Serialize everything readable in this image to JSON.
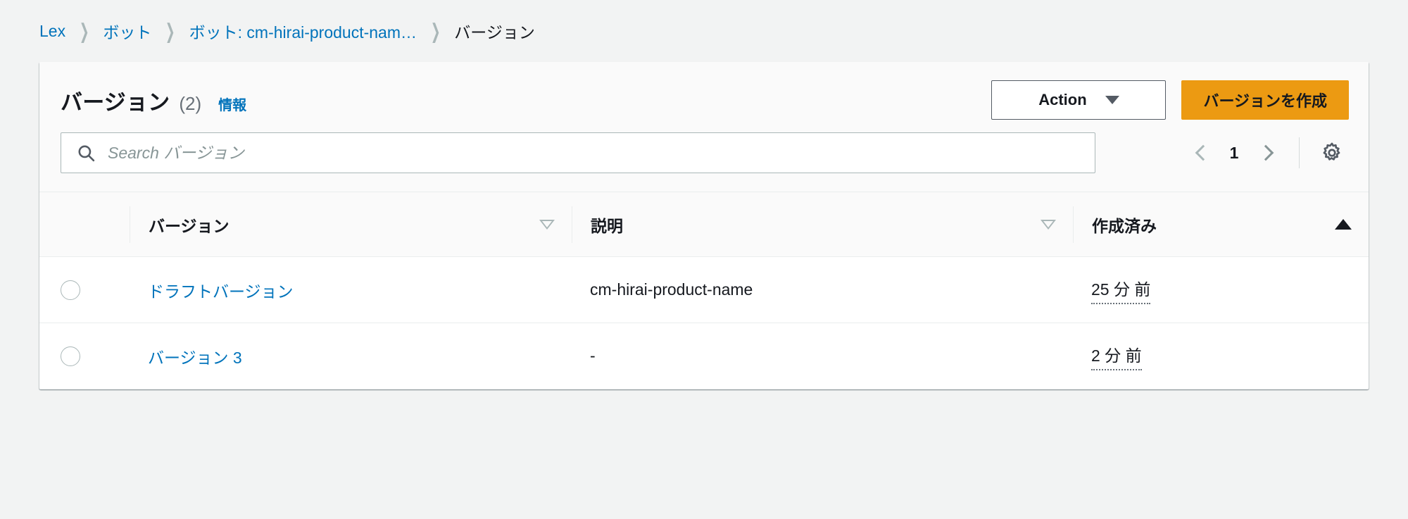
{
  "breadcrumb": {
    "items": [
      {
        "label": "Lex",
        "current": false
      },
      {
        "label": "ボット",
        "current": false
      },
      {
        "label": "ボット: cm-hirai-product-nam…",
        "current": false
      },
      {
        "label": "バージョン",
        "current": true
      }
    ],
    "separator": "❯"
  },
  "panel": {
    "title": "バージョン",
    "count": "(2)",
    "info_label": "情報",
    "actions": {
      "action_button": "Action",
      "create_button": "バージョンを作成"
    }
  },
  "search": {
    "placeholder": "Search バージョン",
    "value": ""
  },
  "pagination": {
    "page": "1",
    "prev_label": "前へ",
    "next_label": "次へ",
    "settings_label": "設定"
  },
  "table": {
    "columns": [
      {
        "key": "select",
        "label": "",
        "sort": "none"
      },
      {
        "key": "version",
        "label": "バージョン",
        "sort": "inactive"
      },
      {
        "key": "description",
        "label": "説明",
        "sort": "inactive"
      },
      {
        "key": "created",
        "label": "作成済み",
        "sort": "asc"
      }
    ],
    "rows": [
      {
        "version": "ドラフトバージョン",
        "description": "cm-hirai-product-name",
        "created": "25 分 前",
        "selected": false
      },
      {
        "version": "バージョン 3",
        "description": "-",
        "created": "2 分 前",
        "selected": false
      }
    ]
  },
  "colors": {
    "page_background": "#f2f3f3",
    "link": "#0073bb",
    "primary_button": "#ec9a12",
    "text": "#16191f",
    "muted": "#687078",
    "border": "#eaeded"
  }
}
